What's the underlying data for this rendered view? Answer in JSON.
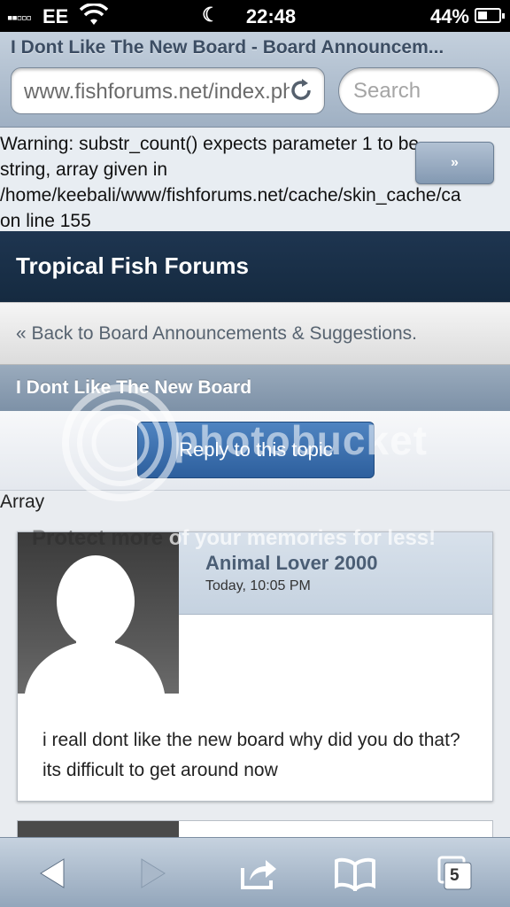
{
  "status_bar": {
    "carrier": "EE",
    "time": "22:48",
    "battery_percent": "44%",
    "battery_level": 0.44
  },
  "browser": {
    "page_title": "I Dont Like The New Board - Board Announcem...",
    "url": "www.fishforums.net/index.php",
    "search_placeholder": "Search"
  },
  "warning": {
    "lines": [
      "Warning: substr_count() expects parameter 1 to be",
      "string, array given in",
      "/home/keebali/www/fishforums.net/cache/skin_cache/ca",
      "on line 155"
    ],
    "expand_label": "»"
  },
  "forum": {
    "title": "Tropical Fish Forums",
    "back_link": "« Back to Board Announcements & Suggestions.",
    "topic_title": "I Dont Like The New Board",
    "reply_label": "Reply to this topic",
    "array_text": "Array"
  },
  "post": {
    "author": "Animal Lover 2000",
    "date": "Today, 10:05 PM",
    "body": "i reall dont like the new board why did you do that? its difficult to get around now"
  },
  "watermark": {
    "brand": "photobucket",
    "tagline_a": "Protect more",
    "tagline_b": " of your memories for less!"
  },
  "toolbar": {
    "tab_count": "5"
  },
  "colors": {
    "forum_header": "#1e3550",
    "reply_button": "#3a6dad",
    "toolbar": "#a9b8c9"
  }
}
